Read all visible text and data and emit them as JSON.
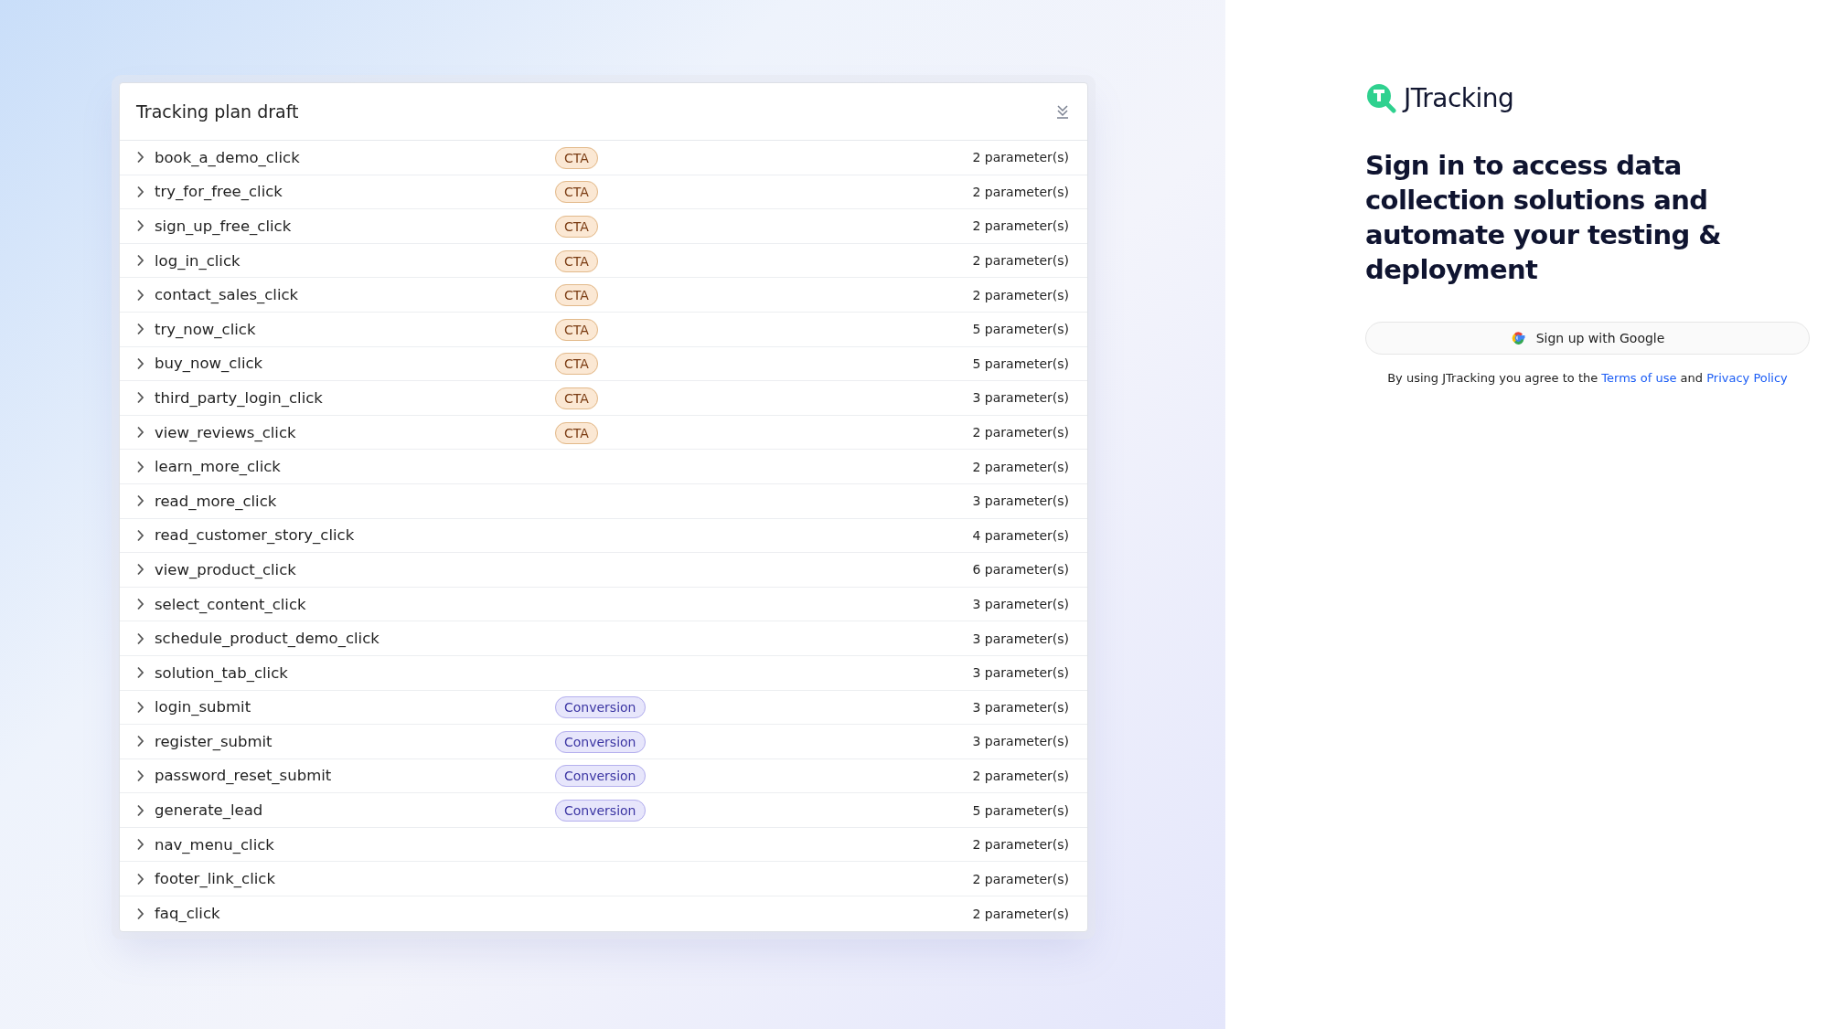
{
  "tracking_plan": {
    "title": "Tracking plan draft",
    "events": [
      {
        "name": "book_a_demo_click",
        "tag": {
          "label": "CTA",
          "kind": "cta"
        },
        "params": "2 parameter(s)"
      },
      {
        "name": "try_for_free_click",
        "tag": {
          "label": "CTA",
          "kind": "cta"
        },
        "params": "2 parameter(s)"
      },
      {
        "name": "sign_up_free_click",
        "tag": {
          "label": "CTA",
          "kind": "cta"
        },
        "params": "2 parameter(s)"
      },
      {
        "name": "log_in_click",
        "tag": {
          "label": "CTA",
          "kind": "cta"
        },
        "params": "2 parameter(s)"
      },
      {
        "name": "contact_sales_click",
        "tag": {
          "label": "CTA",
          "kind": "cta"
        },
        "params": "2 parameter(s)"
      },
      {
        "name": "try_now_click",
        "tag": {
          "label": "CTA",
          "kind": "cta"
        },
        "params": "5 parameter(s)"
      },
      {
        "name": "buy_now_click",
        "tag": {
          "label": "CTA",
          "kind": "cta"
        },
        "params": "5 parameter(s)"
      },
      {
        "name": "third_party_login_click",
        "tag": {
          "label": "CTA",
          "kind": "cta"
        },
        "params": "3 parameter(s)"
      },
      {
        "name": "view_reviews_click",
        "tag": {
          "label": "CTA",
          "kind": "cta"
        },
        "params": "2 parameter(s)"
      },
      {
        "name": "learn_more_click",
        "params": "2 parameter(s)"
      },
      {
        "name": "read_more_click",
        "params": "3 parameter(s)"
      },
      {
        "name": "read_customer_story_click",
        "params": "4 parameter(s)"
      },
      {
        "name": "view_product_click",
        "params": "6 parameter(s)"
      },
      {
        "name": "select_content_click",
        "params": "3 parameter(s)"
      },
      {
        "name": "schedule_product_demo_click",
        "params": "3 parameter(s)"
      },
      {
        "name": "solution_tab_click",
        "params": "3 parameter(s)"
      },
      {
        "name": "login_submit",
        "tag": {
          "label": "Conversion",
          "kind": "conversion"
        },
        "params": "3 parameter(s)"
      },
      {
        "name": "register_submit",
        "tag": {
          "label": "Conversion",
          "kind": "conversion"
        },
        "params": "3 parameter(s)"
      },
      {
        "name": "password_reset_submit",
        "tag": {
          "label": "Conversion",
          "kind": "conversion"
        },
        "params": "2 parameter(s)"
      },
      {
        "name": "generate_lead",
        "tag": {
          "label": "Conversion",
          "kind": "conversion"
        },
        "params": "5 parameter(s)"
      },
      {
        "name": "nav_menu_click",
        "params": "2 parameter(s)"
      },
      {
        "name": "footer_link_click",
        "params": "2 parameter(s)"
      },
      {
        "name": "faq_click",
        "params": "2 parameter(s)"
      }
    ]
  },
  "sign_in": {
    "brand": "JTracking",
    "heading": "Sign in to access data collection solutions and automate your testing & deployment",
    "google_button": "Sign up with Google",
    "legal": [
      {
        "text": "By using JTracking you agree to the ",
        "kind": "plain"
      },
      {
        "text": "Terms of use",
        "kind": "link"
      },
      {
        "text": " and ",
        "kind": "plain"
      },
      {
        "text": "Privacy Policy",
        "kind": "link"
      }
    ]
  }
}
